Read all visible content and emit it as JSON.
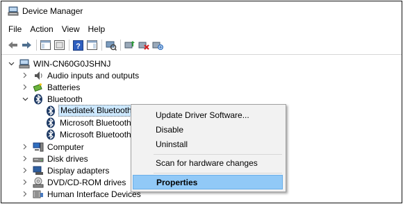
{
  "window": {
    "title": "Device Manager"
  },
  "menubar": [
    "File",
    "Action",
    "View",
    "Help"
  ],
  "toolbar": {
    "buttons": [
      "back-arrow-icon",
      "forward-arrow-icon",
      "show-hide-tree-icon",
      "properties-icon",
      "help-icon",
      "action-pane-icon",
      "scan-hardware-icon",
      "update-driver-icon",
      "uninstall-device-icon",
      "disable-device-icon"
    ]
  },
  "tree": {
    "root": "WIN-CN60G0JSHNJ",
    "items": [
      {
        "label": "Audio inputs and outputs",
        "expanded": false
      },
      {
        "label": "Batteries",
        "expanded": false
      },
      {
        "label": "Bluetooth",
        "expanded": true
      },
      {
        "label": "Mediatek Bluetooth A",
        "child": true,
        "selected": true
      },
      {
        "label": "Microsoft Bluetooth E",
        "child": true
      },
      {
        "label": "Microsoft Bluetooth L",
        "child": true
      },
      {
        "label": "Computer",
        "expanded": false
      },
      {
        "label": "Disk drives",
        "expanded": false
      },
      {
        "label": "Display adapters",
        "expanded": false
      },
      {
        "label": "DVD/CD-ROM drives",
        "expanded": false
      },
      {
        "label": "Human Interface Devices",
        "expanded": false
      }
    ]
  },
  "context_menu": {
    "items": [
      "Update Driver Software...",
      "Disable",
      "Uninstall",
      "Scan for hardware changes",
      "Properties"
    ],
    "highlighted": "Properties"
  }
}
